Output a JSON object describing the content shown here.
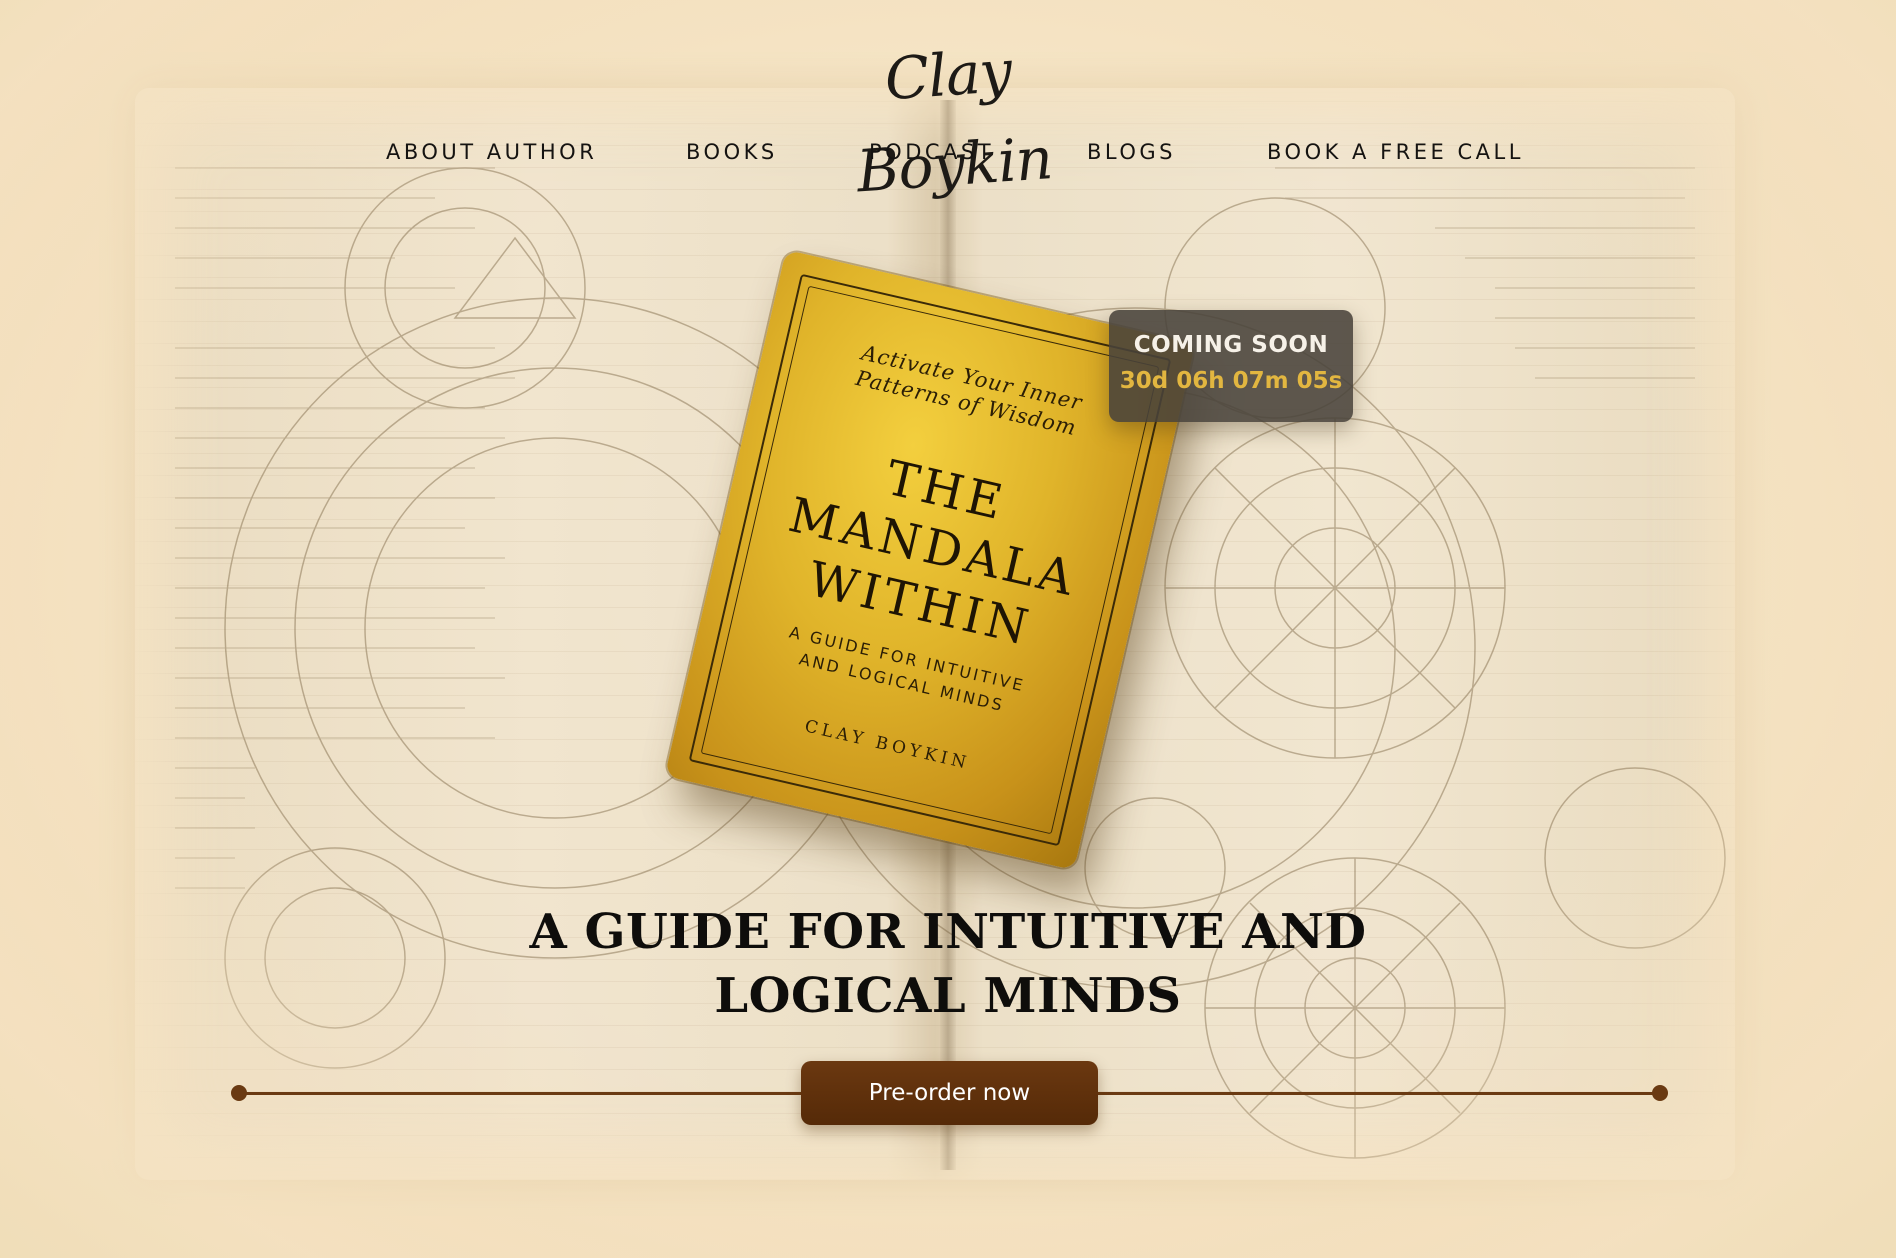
{
  "header": {
    "logo_text": "Clay Boykin"
  },
  "nav": {
    "items": [
      {
        "label": "ABOUT AUTHOR"
      },
      {
        "label": "BOOKS"
      },
      {
        "label": "PODCAST"
      },
      {
        "label": "BLOGS"
      },
      {
        "label": "BOOK A FREE CALL"
      }
    ]
  },
  "book": {
    "tagline_line1": "Activate Your Inner",
    "tagline_line2": "Patterns of Wisdom",
    "title_line1": "THE",
    "title_line2": "MANDALA",
    "title_line3": "WITHIN",
    "subtitle_line1": "A GUIDE FOR INTUITIVE",
    "subtitle_line2": "AND LOGICAL MINDS",
    "author": "CLAY BOYKIN"
  },
  "countdown": {
    "label": "COMING SOON",
    "timer": "30d 06h 07m 05s"
  },
  "hero": {
    "headline_line1": "A GUIDE FOR INTUITIVE AND",
    "headline_line2": "LOGICAL MINDS"
  },
  "cta": {
    "preorder_label": "Pre-order now"
  },
  "colors": {
    "background": "#f5e3c3",
    "accent_brown": "#6a3a12",
    "countdown_bg": "#48423a",
    "countdown_timer": "#e2b640",
    "book_gold": "#e0b42a"
  }
}
